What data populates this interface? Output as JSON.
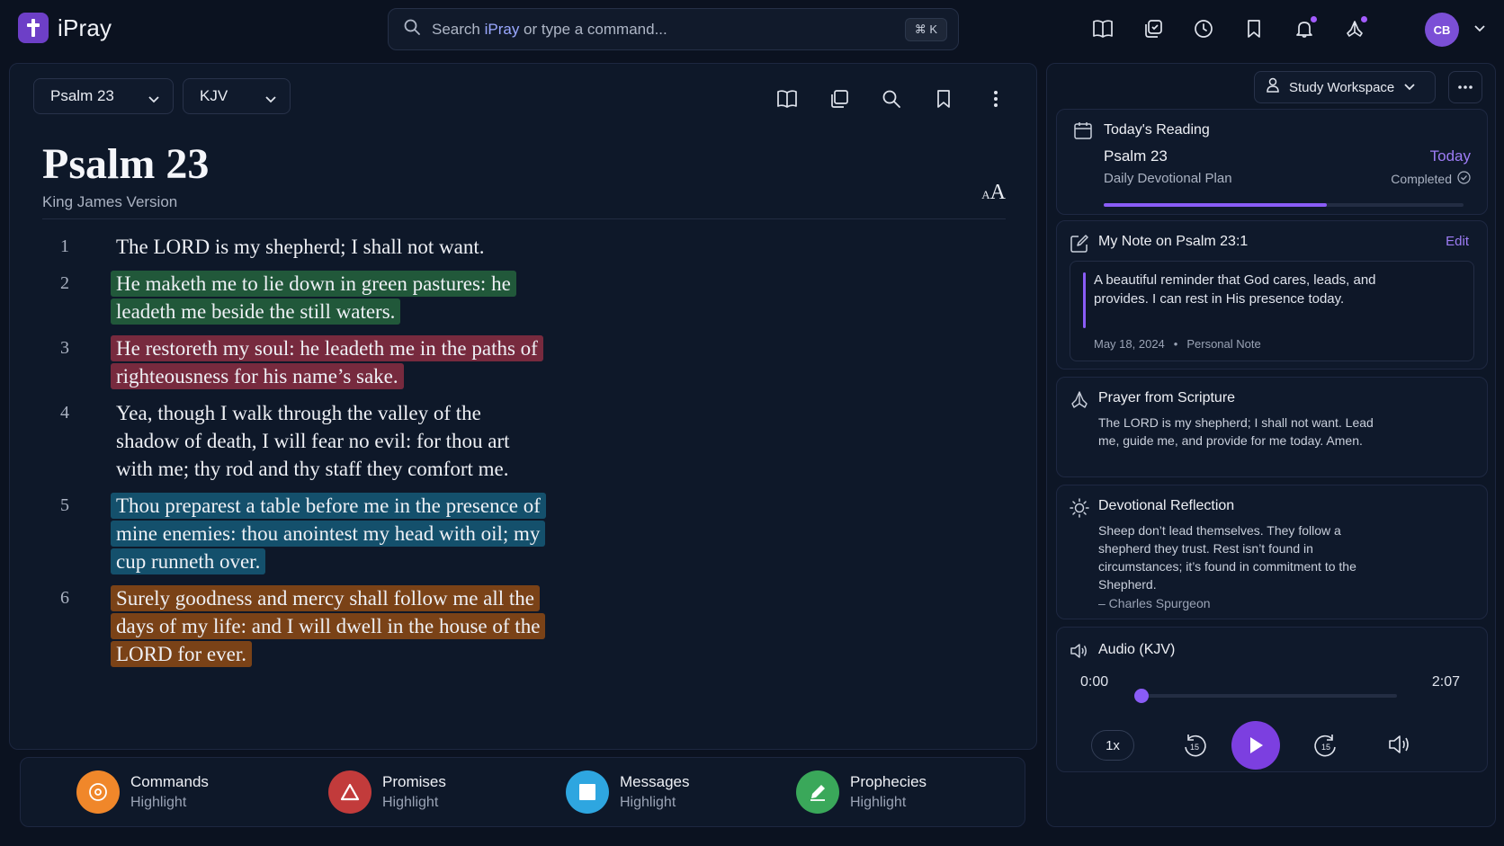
{
  "app": {
    "name": "iPray"
  },
  "search": {
    "prefix": "Search ",
    "brand": "iPray",
    "suffix": " or type a command...",
    "shortcut": "⌘ K"
  },
  "user": {
    "initials": "CB"
  },
  "reader": {
    "book_select": "Psalm 23",
    "version_select": "KJV",
    "title": "Psalm 23",
    "subtitle": "King James Version",
    "font_small": "A",
    "font_big": "A",
    "verses": [
      {
        "num": "1",
        "text": "The LORD is my shepherd; I shall not want.",
        "highlight": "none"
      },
      {
        "num": "2",
        "text": "He maketh me to lie down in green pastures: he leadeth me beside the still waters.",
        "highlight": "green"
      },
      {
        "num": "3",
        "text": "He restoreth my soul: he leadeth me in the paths of righteousness for his name’s sake.",
        "highlight": "red"
      },
      {
        "num": "4",
        "text": "Yea, though I walk through the valley of the shadow of death, I will fear no evil: for thou art with me; thy rod and thy staff they comfort me.",
        "highlight": "none"
      },
      {
        "num": "5",
        "text": "Thou preparest a table before me in the presence of mine enemies: thou anointest my head with oil; my cup runneth over.",
        "highlight": "blue"
      },
      {
        "num": "6",
        "text": "Surely goodness and mercy shall follow me all the days of my life: and I will dwell in the house of the LORD for ever.",
        "highlight": "orange"
      }
    ]
  },
  "legend": [
    {
      "label": "Commands",
      "sub": "Highlight",
      "color": "#f0872a"
    },
    {
      "label": "Promises",
      "sub": "Highlight",
      "color": "#c23b3b"
    },
    {
      "label": "Messages",
      "sub": "Highlight",
      "color": "#2ea6e0"
    },
    {
      "label": "Prophecies",
      "sub": "Highlight",
      "color": "#3aa85a"
    }
  ],
  "side": {
    "workspace": "Study Workspace",
    "reading": {
      "title": "Today's Reading",
      "passage": "Psalm 23",
      "when": "Today",
      "plan": "Daily Devotional Plan",
      "status": "Completed",
      "progress": 0.62
    },
    "note": {
      "title": "My Note on Psalm 23:1",
      "action": "Edit",
      "text": "A beautiful reminder that God cares, leads, and provides. I can rest in His presence today.",
      "date": "May 18, 2024",
      "sep": "•",
      "type": "Personal Note"
    },
    "prayer": {
      "title": "Prayer from Scripture",
      "text": "The LORD is my shepherd; I shall not want. Lead me, guide me, and provide for me today. Amen."
    },
    "reflection": {
      "title": "Devotional Reflection",
      "text": "Sheep don’t lead themselves. They follow a shepherd they trust. Rest isn’t found in circumstances; it’s found in commitment to the Shepherd.",
      "author": "– Charles Spurgeon"
    },
    "audio": {
      "title": "Audio (KJV)",
      "current": "0:00",
      "total": "2:07",
      "speed": "1x",
      "skip": "15",
      "progress": 0
    }
  }
}
